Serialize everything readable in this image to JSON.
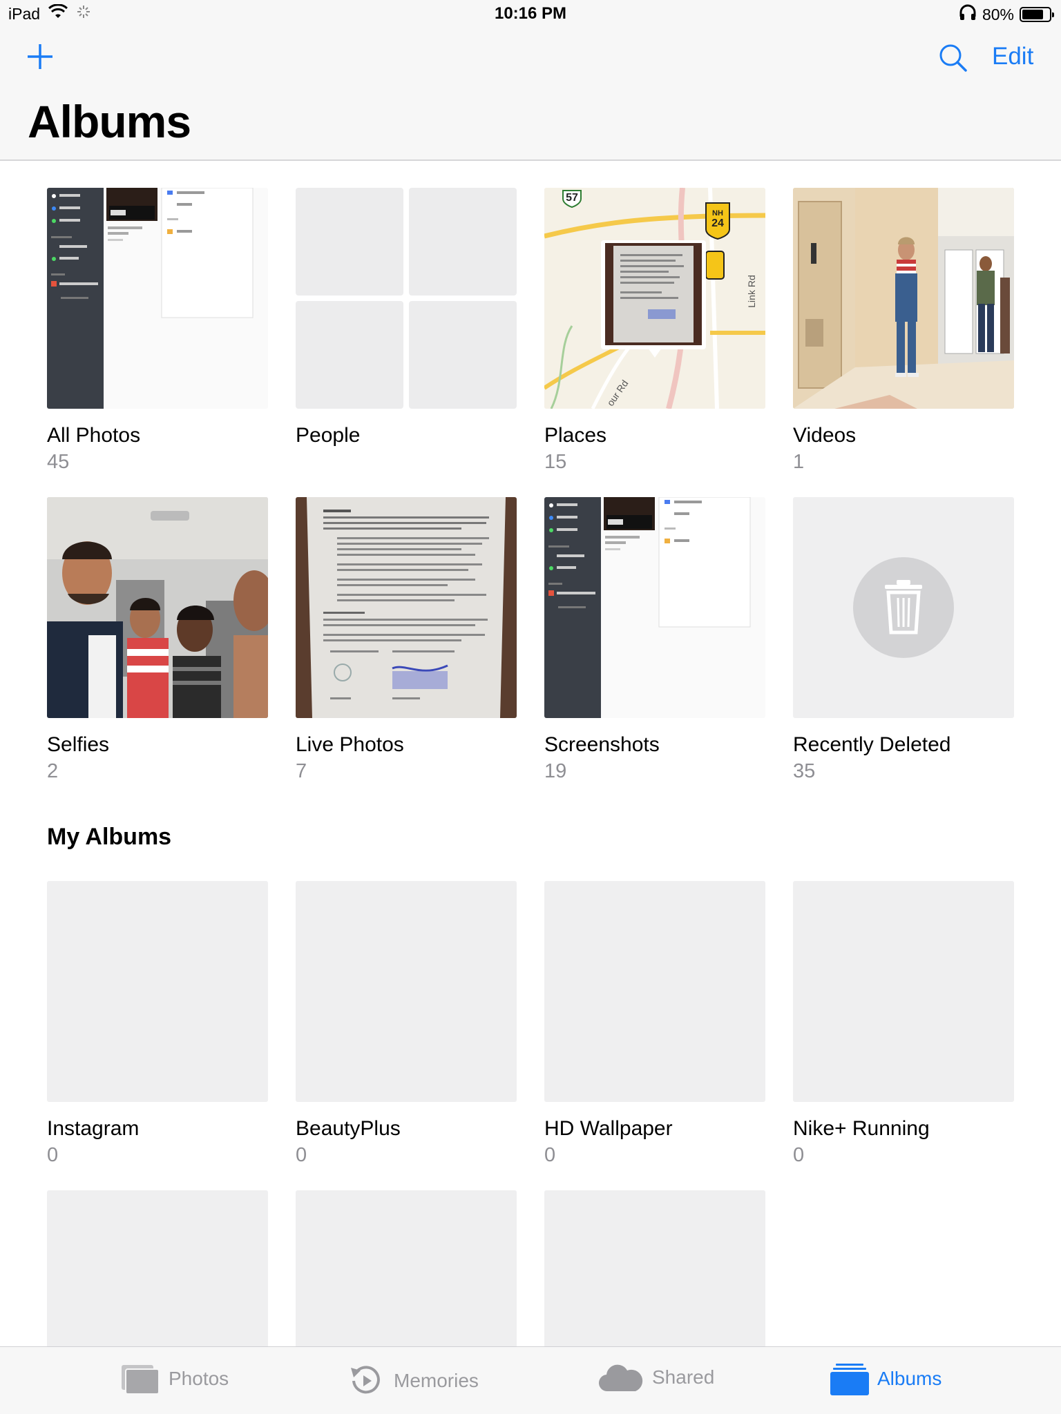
{
  "status_bar": {
    "device": "iPad",
    "time": "10:16 PM",
    "battery": "80%",
    "battery_level": 0.8
  },
  "nav": {
    "title": "Albums",
    "edit_label": "Edit"
  },
  "albums": [
    {
      "name": "All Photos",
      "count": "45"
    },
    {
      "name": "People",
      "count": ""
    },
    {
      "name": "Places",
      "count": "15"
    },
    {
      "name": "Videos",
      "count": "1"
    },
    {
      "name": "Selfies",
      "count": "2"
    },
    {
      "name": "Live Photos",
      "count": "7"
    },
    {
      "name": "Screenshots",
      "count": "19"
    },
    {
      "name": "Recently Deleted",
      "count": "35"
    }
  ],
  "my_albums": {
    "title": "My Albums",
    "items": [
      {
        "name": "Instagram",
        "count": "0"
      },
      {
        "name": "BeautyPlus",
        "count": "0"
      },
      {
        "name": "HD Wallpaper",
        "count": "0"
      },
      {
        "name": "Nike+ Running",
        "count": "0"
      }
    ]
  },
  "map": {
    "route_57": "57",
    "nh_top": "NH",
    "nh_num": "24",
    "road_link": "Link Rd",
    "road_our": "our Rd"
  },
  "tabs": [
    {
      "label": "Photos",
      "icon": "photos-stack-icon",
      "active": false
    },
    {
      "label": "Memories",
      "icon": "memories-icon",
      "active": false
    },
    {
      "label": "Shared",
      "icon": "cloud-icon",
      "active": false
    },
    {
      "label": "Albums",
      "icon": "albums-folder-icon",
      "active": true
    }
  ],
  "colors": {
    "accent": "#1a7cf5",
    "secondary_text": "#8e8e93",
    "placeholder": "#efeff0"
  }
}
